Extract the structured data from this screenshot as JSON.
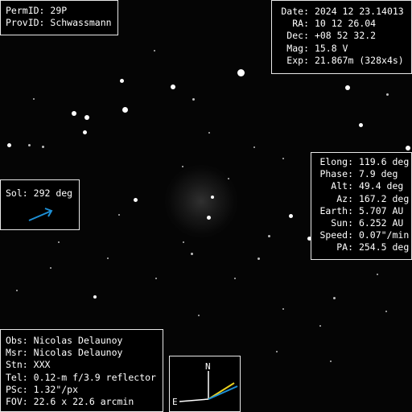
{
  "object": {
    "perm_label": "PermID:",
    "perm_value": "29P",
    "prov_label": "ProvID:",
    "prov_value": "Schwassmann"
  },
  "ephemeris": {
    "rows": [
      {
        "label": "Date:",
        "value": "2024 12 23.14013"
      },
      {
        "label": "RA:",
        "value": "10 12 26.04"
      },
      {
        "label": "Dec:",
        "value": "+08 52 32.2"
      },
      {
        "label": "Mag:",
        "value": "15.8 V"
      },
      {
        "label": "Exp:",
        "value": "21.867m (328x4s)"
      }
    ]
  },
  "geometry": {
    "rows": [
      {
        "label": "Elong:",
        "value": "119.6 deg"
      },
      {
        "label": "Phase:",
        "value": "7.9 deg"
      },
      {
        "label": "Alt:",
        "value": "49.4 deg"
      },
      {
        "label": "Az:",
        "value": "167.2 deg"
      },
      {
        "label": "Earth:",
        "value": "5.707 AU"
      },
      {
        "label": "Sun:",
        "value": "6.252 AU"
      },
      {
        "label": "Speed:",
        "value": "0.07\"/min"
      },
      {
        "label": "PA:",
        "value": "254.5 deg"
      }
    ]
  },
  "sol": {
    "label": "Sol:",
    "value": "292 deg",
    "arrow_color": "#1e90d6",
    "arrow_icon": "sun-direction-arrow-icon"
  },
  "observer": {
    "rows": [
      {
        "label": "Obs:",
        "value": "Nicolas Delaunoy"
      },
      {
        "label": "Msr:",
        "value": "Nicolas Delaunoy"
      },
      {
        "label": "Stn:",
        "value": "XXX"
      },
      {
        "label": "Tel:",
        "value": "0.12-m f/3.9 reflector"
      },
      {
        "label": "PSc:",
        "value": "1.32\"/px"
      },
      {
        "label": "FOV:",
        "value": "22.6 x 22.6 arcmin"
      }
    ]
  },
  "compass": {
    "north_label": "N",
    "east_label": "E",
    "motion_color_1": "#e8d020",
    "motion_color_2": "#1e90d6",
    "icon": "compass-orientation-icon"
  }
}
